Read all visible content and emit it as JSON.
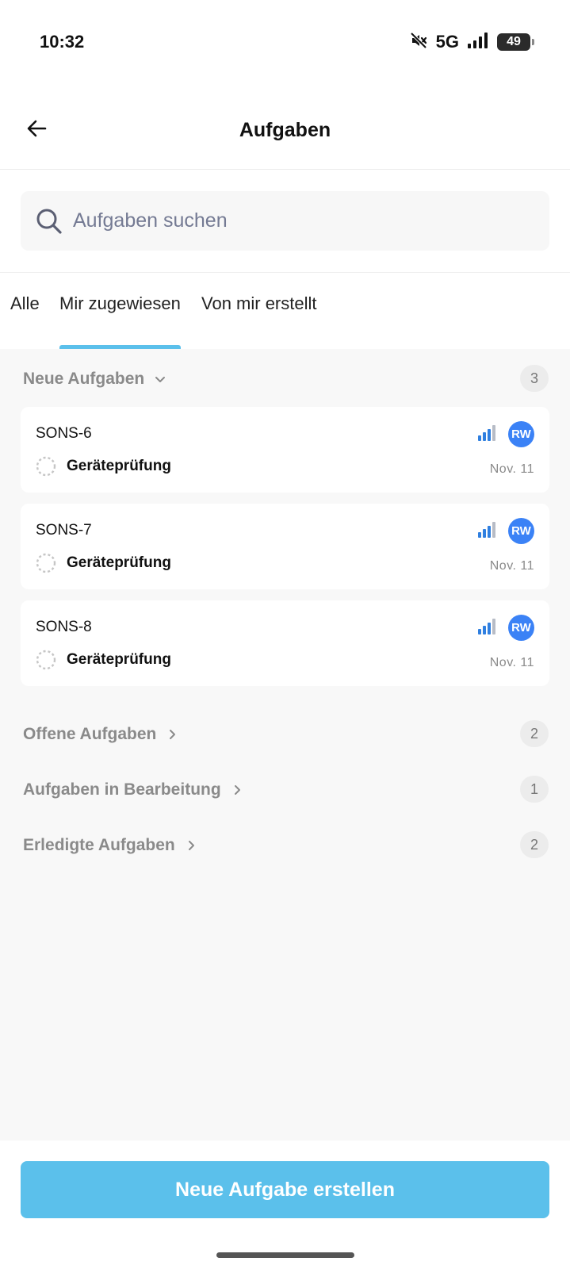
{
  "status_bar": {
    "time": "10:32",
    "network": "5G",
    "battery": "49"
  },
  "header": {
    "title": "Aufgaben"
  },
  "search": {
    "placeholder": "Aufgaben suchen"
  },
  "tabs": [
    {
      "label": "Alle",
      "active": false
    },
    {
      "label": "Mir zugewiesen",
      "active": true
    },
    {
      "label": "Von mir erstellt",
      "active": false
    }
  ],
  "sections": [
    {
      "title": "Neue Aufgaben",
      "count": "3",
      "expanded": true,
      "tasks": [
        {
          "id": "SONS-6",
          "title": "Geräteprüfung",
          "assignee": "RW",
          "date": "Nov. 11"
        },
        {
          "id": "SONS-7",
          "title": "Geräteprüfung",
          "assignee": "RW",
          "date": "Nov. 11"
        },
        {
          "id": "SONS-8",
          "title": "Geräteprüfung",
          "assignee": "RW",
          "date": "Nov. 11"
        }
      ]
    },
    {
      "title": "Offene Aufgaben",
      "count": "2",
      "expanded": false
    },
    {
      "title": "Aufgaben in Bearbeitung",
      "count": "1",
      "expanded": false
    },
    {
      "title": "Erledigte Aufgaben",
      "count": "2",
      "expanded": false
    }
  ],
  "footer": {
    "create_button_label": "Neue Aufgabe erstellen"
  },
  "colors": {
    "accent": "#5bc0eb",
    "avatar": "#3b82f6",
    "priority": "#2f7fe0"
  },
  "icons": {
    "back": "arrow-left-icon",
    "search": "search-icon",
    "expanded": "chevron-down-icon",
    "collapsed": "chevron-right-icon",
    "task_status": "dashed-circle-icon",
    "priority": "signal-bars-icon"
  }
}
